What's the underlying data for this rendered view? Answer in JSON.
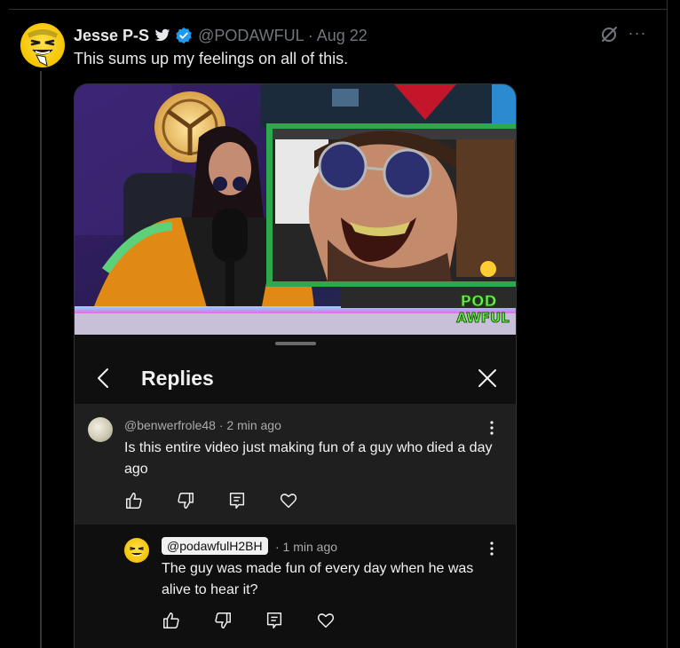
{
  "tweet": {
    "display_name": "Jesse P-S",
    "handle": "@PODAWFUL",
    "separator": "·",
    "date": "Aug 22",
    "text": "This sums up my feelings on all of this."
  },
  "icons": {
    "bird": "twitter-bird-icon",
    "verified": "verified-badge-icon",
    "grok": "grok-icon",
    "more": "more-options-icon",
    "more_glyph": "···"
  },
  "colors": {
    "background": "#000000",
    "verified_blue": "#1d9bf0",
    "secondary_text": "#71767b",
    "reply_chip": "#f1f1f1"
  },
  "sheet": {
    "title": "Replies"
  },
  "comment": {
    "author": "@benwerfrole48",
    "time": "2 min ago",
    "text": "Is this entire video just making fun of a guy who died a day ago"
  },
  "reply": {
    "author": "@podawfulH2BH",
    "time": "· 1 min ago",
    "text": "The guy was made fun of every day when he was alive to hear it?"
  }
}
